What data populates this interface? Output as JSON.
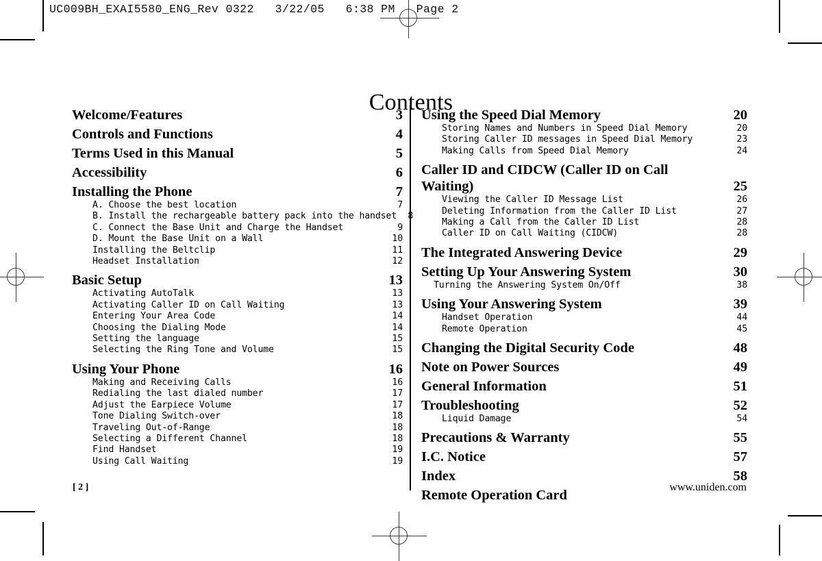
{
  "proof_header": "UC009BH_EXAI5580_ENG_Rev 0322   3/22/05   6:38 PM   Page 2",
  "document": {
    "title": "Contents",
    "footer_page_label": "[ 2 ]",
    "footer_url": "www.uniden.com"
  },
  "toc": {
    "left_column": [
      {
        "type": "major",
        "label": "Welcome/Features",
        "page": "3"
      },
      {
        "type": "major",
        "label": "Controls and Functions",
        "page": "4"
      },
      {
        "type": "major",
        "label": "Terms Used in this Manual",
        "page": "5"
      },
      {
        "type": "major",
        "label": "Accessibility",
        "page": "6"
      },
      {
        "type": "major",
        "label": "Installing the Phone",
        "page": "7"
      },
      {
        "type": "sub",
        "label": "A. Choose the best location",
        "page": "7"
      },
      {
        "type": "sub",
        "label": "B. Install the rechargeable battery pack into the handset",
        "page": "8"
      },
      {
        "type": "sub",
        "label": "C. Connect the Base Unit and Charge the Handset",
        "page": "9"
      },
      {
        "type": "sub",
        "label": "D. Mount the Base Unit on a Wall",
        "page": "10"
      },
      {
        "type": "sub",
        "label": "Installing the Beltclip",
        "page": "11"
      },
      {
        "type": "sub",
        "label": "Headset Installation",
        "page": "12"
      },
      {
        "type": "major",
        "label": "Basic Setup",
        "page": "13"
      },
      {
        "type": "sub",
        "label": "Activating AutoTalk",
        "page": "13"
      },
      {
        "type": "sub",
        "label": "Activating Caller ID on Call Waiting",
        "page": "13"
      },
      {
        "type": "sub",
        "label": "Entering Your Area Code",
        "page": "14"
      },
      {
        "type": "sub",
        "label": "Choosing the Dialing Mode",
        "page": "14"
      },
      {
        "type": "sub",
        "label": "Setting the language",
        "page": "15"
      },
      {
        "type": "sub",
        "label": "Selecting the Ring Tone and Volume",
        "page": "15"
      },
      {
        "type": "major",
        "label": "Using Your Phone",
        "page": "16"
      },
      {
        "type": "sub",
        "label": "Making and Receiving Calls",
        "page": "16"
      },
      {
        "type": "sub",
        "label": "Redialing the last dialed number",
        "page": "17"
      },
      {
        "type": "sub",
        "label": "Adjust the Earpiece Volume",
        "page": "17"
      },
      {
        "type": "sub",
        "label": "Tone Dialing Switch-over",
        "page": "18"
      },
      {
        "type": "sub",
        "label": "Traveling Out-of-Range",
        "page": "18"
      },
      {
        "type": "sub",
        "label": "Selecting a Different Channel",
        "page": "18"
      },
      {
        "type": "sub",
        "label": "Find Handset",
        "page": "19"
      },
      {
        "type": "sub",
        "label": "Using Call Waiting",
        "page": "19"
      }
    ],
    "right_column": [
      {
        "type": "major",
        "label": "Using the Speed Dial Memory",
        "page": "20"
      },
      {
        "type": "sub",
        "label": "Storing Names and Numbers in Speed Dial Memory",
        "page": "20"
      },
      {
        "type": "sub",
        "label": "Storing Caller ID messages in Speed Dial Memory",
        "page": "23"
      },
      {
        "type": "sub",
        "label": "Making Calls from Speed Dial Memory",
        "page": "24"
      },
      {
        "type": "major_wrap",
        "label_line1": "Caller ID and CIDCW (Caller ID on Call",
        "label_line2": "Waiting)",
        "page": "25"
      },
      {
        "type": "sub",
        "label": "Viewing the Caller ID Message List",
        "page": "26"
      },
      {
        "type": "sub",
        "label": "Deleting Information from the Caller ID List",
        "page": "27"
      },
      {
        "type": "sub",
        "label": "Making a Call from the Caller ID List",
        "page": "28"
      },
      {
        "type": "sub",
        "label": "Caller ID on Call Waiting (CIDCW)",
        "page": "28"
      },
      {
        "type": "major",
        "label": "The Integrated Answering Device",
        "page": "29"
      },
      {
        "type": "major",
        "label": "Setting Up Your Answering System",
        "page": "30"
      },
      {
        "type": "sub_small_indent",
        "label": "Turning the Answering System On/Off",
        "page": "38"
      },
      {
        "type": "major",
        "label": "Using Your Answering System",
        "page": "39"
      },
      {
        "type": "sub",
        "label": "Handset Operation",
        "page": "44"
      },
      {
        "type": "sub",
        "label": "Remote Operation",
        "page": "45"
      },
      {
        "type": "major",
        "label": "Changing the Digital Security Code",
        "page": "48"
      },
      {
        "type": "major",
        "label": "Note on Power Sources",
        "page": "49"
      },
      {
        "type": "major",
        "label": "General Information",
        "page": "51"
      },
      {
        "type": "major",
        "label": "Troubleshooting",
        "page": "52"
      },
      {
        "type": "sub",
        "label": "Liquid Damage",
        "page": "54"
      },
      {
        "type": "major",
        "label": "Precautions & Warranty",
        "page": "55"
      },
      {
        "type": "major",
        "label": "I.C. Notice",
        "page": "57"
      },
      {
        "type": "major",
        "label": "Index",
        "page": "58"
      },
      {
        "type": "major",
        "label": "Remote Operation Card",
        "page": ""
      }
    ]
  }
}
